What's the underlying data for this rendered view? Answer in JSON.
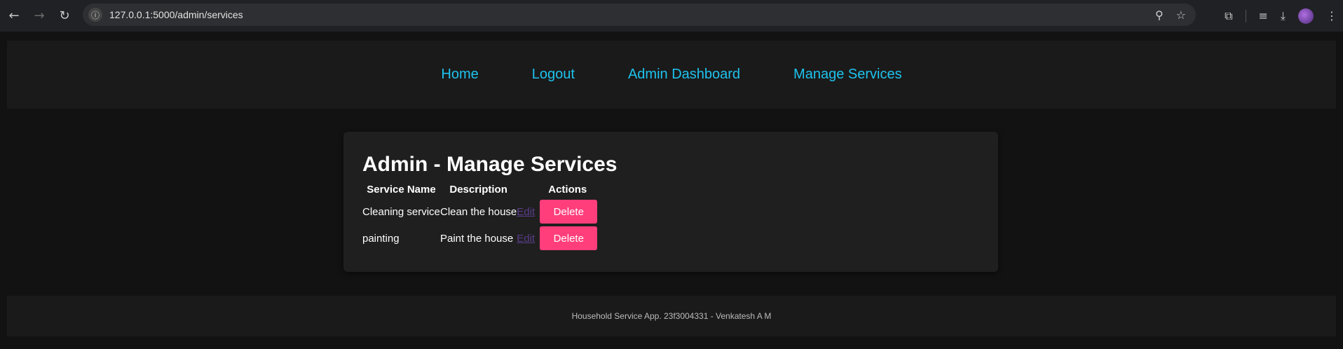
{
  "browser": {
    "url": "127.0.0.1:5000/admin/services",
    "icons": {
      "back": "back-arrow-icon",
      "forward": "forward-arrow-icon",
      "reload": "reload-icon",
      "info": "site-info-icon",
      "zoom": "zoom-icon",
      "bookmark": "star-icon",
      "extensions": "extensions-icon",
      "media": "media-control-icon",
      "download": "download-icon",
      "profile": "profile-avatar"
    }
  },
  "nav": {
    "links": [
      "Home",
      "Logout",
      "Admin Dashboard",
      "Manage Services"
    ],
    "link_color": "#1ec3ee"
  },
  "main": {
    "title": "Admin - Manage Services",
    "headers": [
      "Service Name",
      "Description",
      "",
      "Actions"
    ],
    "rows": [
      {
        "name": "Cleaning service",
        "description": "Clean the house",
        "edit": "Edit",
        "delete": "Delete"
      },
      {
        "name": "painting",
        "description": "Paint the house",
        "edit": "Edit",
        "delete": "Delete"
      }
    ],
    "delete_color": "#ff3e7b"
  },
  "footer": {
    "text": "Household Service App. 23f3004331 - Venkatesh A M"
  }
}
